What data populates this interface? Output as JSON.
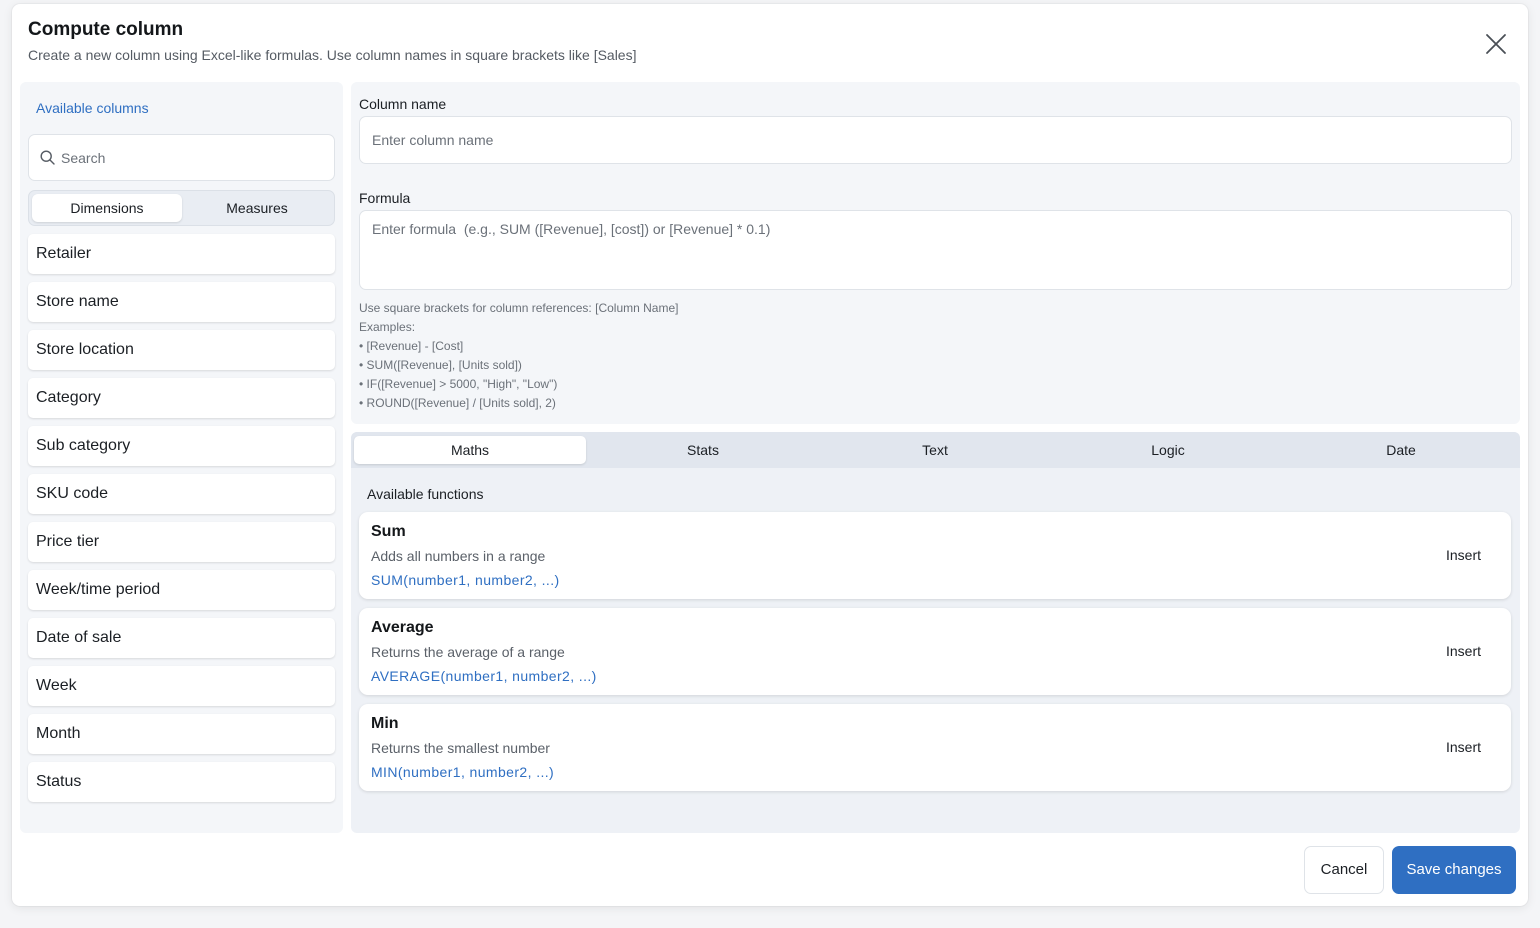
{
  "dialog": {
    "title": "Compute column",
    "subtitle": "Create a new column using Excel-like formulas. Use column names in square brackets like [Sales]"
  },
  "sidebar": {
    "title": "Available columns",
    "search_placeholder": "Search",
    "segments": [
      "Dimensions",
      "Measures"
    ],
    "active_segment": "Dimensions",
    "items": [
      "Retailer",
      "Store name",
      "Store location",
      "Category",
      "Sub category",
      "SKU code",
      "Price tier",
      "Week/time period",
      "Date of sale",
      "Week",
      "Month",
      "Status"
    ]
  },
  "form": {
    "column_name_label": "Column name",
    "column_name_placeholder": "Enter column name",
    "formula_label": "Formula",
    "formula_placeholder": "Enter formula  (e.g., SUM ([Revenue], [cost]) or [Revenue] * 0.1)",
    "help_lines": [
      "Use square brackets for column references: [Column Name]",
      "Examples:",
      "• [Revenue] - [Cost]",
      "• SUM([Revenue], [Units sold])",
      "• IF([Revenue] > 5000, \"High\", \"Low\")",
      "• ROUND([Revenue] / [Units sold], 2)"
    ]
  },
  "functions": {
    "tabs": [
      "Maths",
      "Stats",
      "Text",
      "Logic",
      "Date"
    ],
    "active_tab": "Maths",
    "title": "Available functions",
    "insert_label": "Insert",
    "items": [
      {
        "name": "Sum",
        "description": "Adds all numbers in a range",
        "syntax": "SUM(number1, number2, ...)"
      },
      {
        "name": "Average",
        "description": "Returns the average of a range",
        "syntax": "AVERAGE(number1, number2, ...)"
      },
      {
        "name": "Min",
        "description": "Returns the smallest number",
        "syntax": "MIN(number1, number2, ...)"
      }
    ]
  },
  "footer": {
    "cancel_label": "Cancel",
    "save_label": "Save changes"
  },
  "colors": {
    "accent": "#2f6fc2"
  }
}
